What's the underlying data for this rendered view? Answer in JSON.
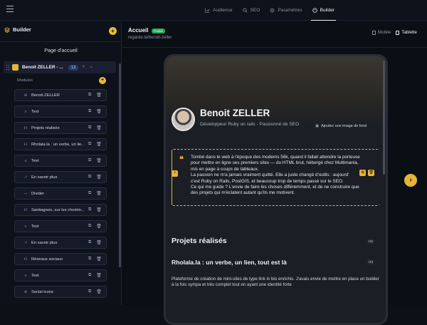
{
  "topbar": {
    "tabs": [
      {
        "label": "Audience",
        "icon": "chart-icon"
      },
      {
        "label": "SEO",
        "icon": "search-icon"
      },
      {
        "label": "Paramètres",
        "icon": "gear-icon"
      },
      {
        "label": "Builder",
        "icon": "palette-icon",
        "active": true
      }
    ]
  },
  "sidebar": {
    "title": "Builder",
    "page_title": "Page d'accueil",
    "page": {
      "name": "Benoit ZELLER - ...",
      "count": "13"
    },
    "modules_label": "Modules",
    "modules": [
      {
        "icon": "⊕",
        "label": "Benoit ZELLER"
      },
      {
        "icon": "≡",
        "label": "Text"
      },
      {
        "icon": "H",
        "label": "Projets réalisés"
      },
      {
        "icon": "H",
        "label": "Rholala.la : un verbe, un lie..."
      },
      {
        "icon": "≡",
        "label": "Text"
      },
      {
        "icon": "↗",
        "label": "En savoir plus"
      },
      {
        "icon": "—",
        "label": "Divider"
      },
      {
        "icon": "H",
        "label": "Santiagooo, sur les chemin..."
      },
      {
        "icon": "≡",
        "label": "Text"
      },
      {
        "icon": "↗",
        "label": "En savoir plus"
      },
      {
        "icon": "H",
        "label": "Réseaux sociaux"
      },
      {
        "icon": "≡",
        "label": "Text"
      },
      {
        "icon": "⊕",
        "label": "Social icons"
      }
    ]
  },
  "main": {
    "title": "Accueil",
    "status": "Publié",
    "url": "regarde.la/benoit-zeller",
    "views": [
      {
        "label": "Mobile",
        "active": false
      },
      {
        "label": "Tablette",
        "active": true
      }
    ]
  },
  "preview": {
    "name": "Benoit ZELLER",
    "role": "Développeur Ruby on rails - Passionné de SEO",
    "bg_link": "Ajoutez une image de fond",
    "quote_lines": [
      "Tombé dans le web à l'époque des modems 56k, quand il fallait attendre la porteuse",
      "pour mettre en ligne ses premiers sites — du HTML brut, hébergé chez Multimania,",
      "mis en page à coups de tableaux.",
      "La passion ne m'a jamais vraiment quitté. Elle a juste changé d'outils : aujourd'",
      "c'est Ruby on Rails, PostGIS, et beaucoup trop de temps passé sur le SEO.",
      "Ce qui me guide ? L'envie de faire les choses différemment, et de ne construire que",
      "des projets qui m'éclatent autant qu'ils me motivent."
    ],
    "h2": "Projets réalisés",
    "h2_tag": "H2",
    "h3": "Rholala.la : un verbe, un lien, tout est là",
    "h3_tag": "H3",
    "paragraph": "Plateforme de création de mini-sites de type link in bio enrichis. J'avais envie de mettre en place un builder à la fois sympa et très complet tout en ayant une identité forte"
  }
}
